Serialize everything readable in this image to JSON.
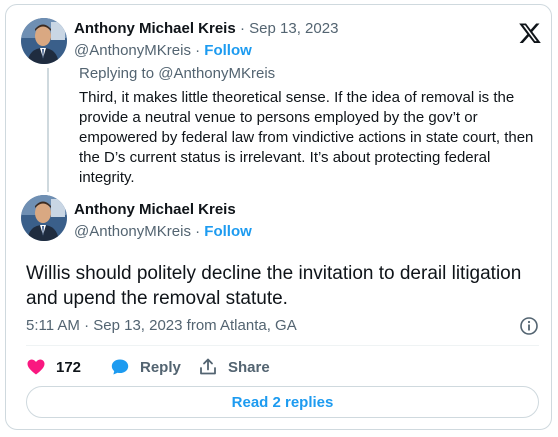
{
  "tweet1": {
    "author_name": "Anthony Michael Kreis",
    "date": "Sep 13, 2023",
    "handle": "@AnthonyMKreis",
    "follow_label": "Follow",
    "replying_to": "Replying to @AnthonyMKreis",
    "text": "Third, it makes little theoretical sense. If the idea of removal is the provide a neutral venue to persons employed by the gov’t or empowered by federal law from vindictive actions in state court, then the D’s current status is irrelevant. It’s about protecting federal integrity."
  },
  "tweet2": {
    "author_name": "Anthony Michael Kreis",
    "handle": "@AnthonyMKreis",
    "follow_label": "Follow",
    "text": "Willis should politely decline the invitation to derail litigation and upend the removal statute.",
    "meta": "5:11 AM · Sep 13, 2023 from Atlanta, GA"
  },
  "actions": {
    "like_count": "172",
    "reply_label": "Reply",
    "share_label": "Share"
  },
  "read_replies_label": "Read 2 replies",
  "colors": {
    "accent": "#1d9bf0",
    "like": "#f91880",
    "secondary_text": "#536471",
    "border": "#cfd9de"
  },
  "icons": {
    "platform_logo": "x-logo-icon",
    "like": "heart-icon",
    "reply": "speech-bubble-icon",
    "share": "share-arrow-icon",
    "info": "info-icon"
  }
}
